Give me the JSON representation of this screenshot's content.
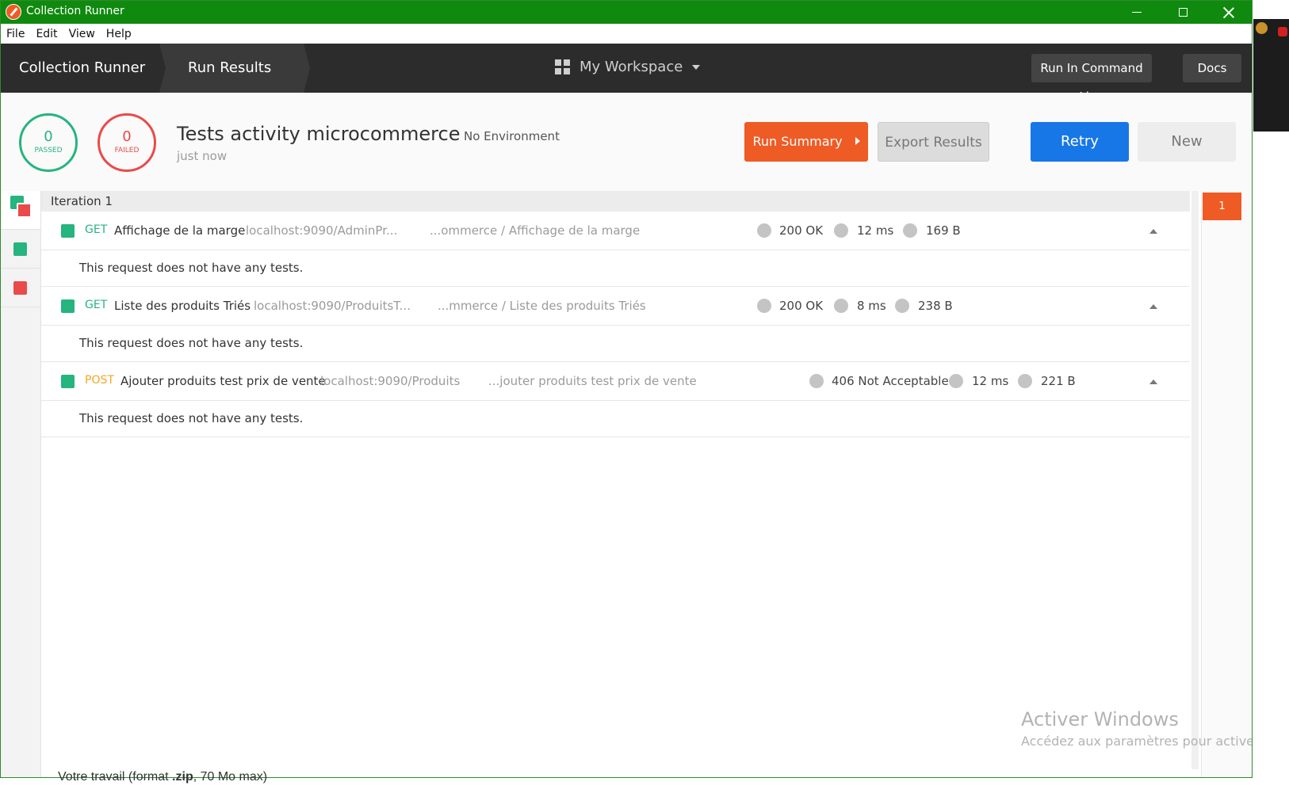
{
  "window": {
    "title": "Collection Runner"
  },
  "menu": [
    "File",
    "Edit",
    "View",
    "Help"
  ],
  "header": {
    "breadcrumb_1": "Collection Runner",
    "breadcrumb_2": "Run Results",
    "workspace": "My Workspace",
    "run_cli_label": "Run In Command Line",
    "docs_label": "Docs"
  },
  "summary": {
    "passed_count": "0",
    "passed_label": "PASSED",
    "failed_count": "0",
    "failed_label": "FAILED",
    "collection_name": "Tests activity microcommerce",
    "environment": "No Environment",
    "time": "just now",
    "run_summary_label": "Run Summary",
    "export_label": "Export Results",
    "retry_label": "Retry",
    "new_label": "New"
  },
  "iteration": {
    "label": "Iteration 1",
    "badge": "1",
    "requests": [
      {
        "method": "GET",
        "name": "Affichage de la marge",
        "url": "localhost:9090/AdminPr...",
        "path": "...ommerce / Affichage de la marge",
        "status": "200 OK",
        "time": "12 ms",
        "size": "169 B",
        "note": "This request does not have any tests."
      },
      {
        "method": "GET",
        "name": "Liste des produits Triés",
        "url": "localhost:9090/ProduitsT...",
        "path": "...mmerce / Liste des produits Triés",
        "status": "200 OK",
        "time": "8 ms",
        "size": "238 B",
        "note": "This request does not have any tests."
      },
      {
        "method": "POST",
        "name": "Ajouter produits test prix de vente",
        "url": "localhost:9090/Produits",
        "path": "...jouter produits test prix de vente",
        "status": "406 Not Acceptable",
        "time": "12 ms",
        "size": "221 B",
        "note": "This request does not have any tests."
      }
    ]
  },
  "watermark": {
    "line1": "Activer Windows",
    "line2": "Accédez aux paramètres pour activer Windows."
  },
  "below": {
    "prefix": "Votre travail (format ",
    "bold": ".zip",
    "suffix": ", 70 Mo max)"
  },
  "colors": {
    "titlebar": "#0f8a0f",
    "header": "#2c2c2c",
    "accent_orange": "#ef5b25",
    "retry_blue": "#1877e6",
    "pass_green": "#26b47f",
    "fail_red": "#ea4a4a",
    "post_orange": "#f5a623"
  }
}
